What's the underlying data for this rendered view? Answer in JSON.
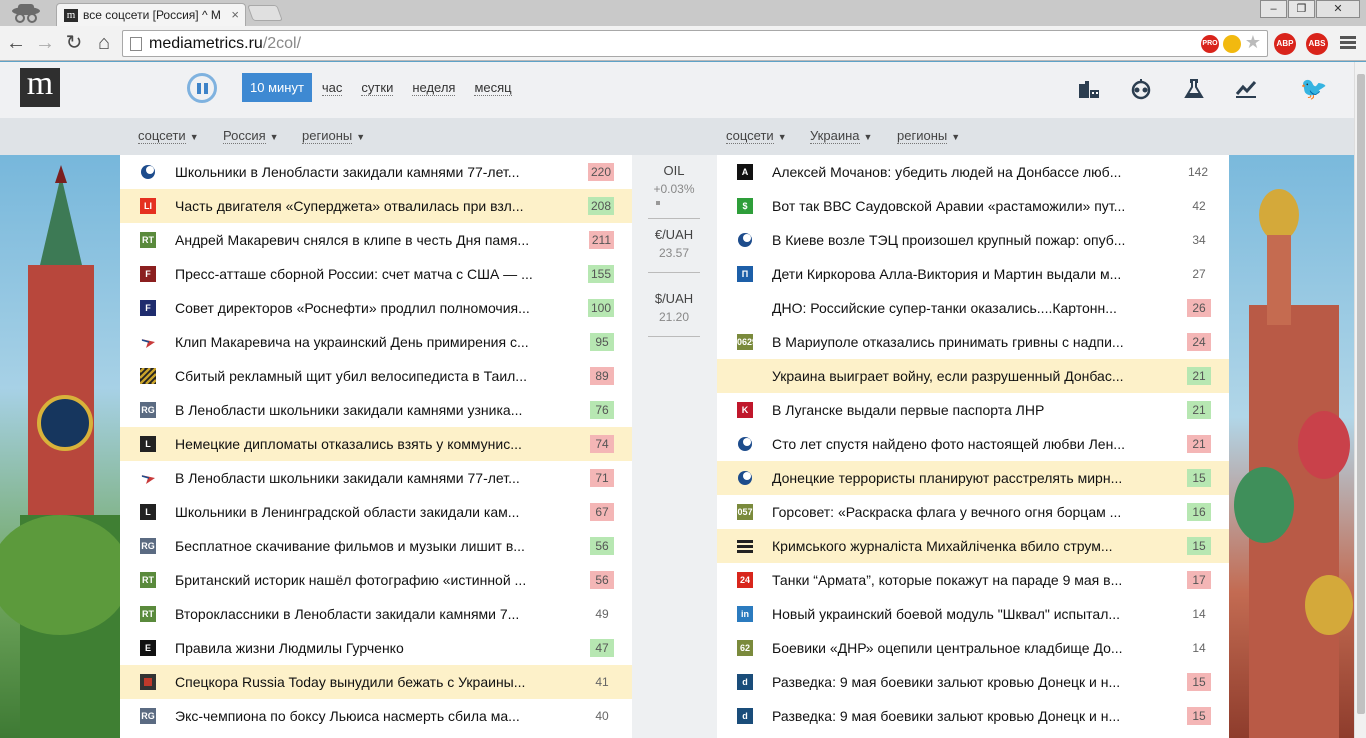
{
  "browser": {
    "tab_title": "все соцсети [Россия] ^ М",
    "url_host": "mediametrics.ru",
    "url_path": "/2col/",
    "ext_abp": "ABP",
    "ext_abs": "ABS",
    "ext_pro": "PRO"
  },
  "site": {
    "logo_letter": "m",
    "periods": [
      "10 минут",
      "час",
      "сутки",
      "неделя",
      "месяц"
    ],
    "left_filters": [
      "соцсети",
      "Россия",
      "регионы"
    ],
    "right_filters": [
      "соцсети",
      "Украина",
      "регионы"
    ]
  },
  "rates": [
    {
      "name": "OIL",
      "value": "+0.03%"
    },
    {
      "name": "€/UAH",
      "value": "23.57"
    },
    {
      "name": "$/UAH",
      "value": "21.20"
    }
  ],
  "left_news": [
    {
      "title": "Школьники в Ленобласти закидали камнями 77-лет...",
      "count": "220",
      "color": "red",
      "hl": false,
      "src": "moon",
      "srcColor": "#1d4c8c"
    },
    {
      "title": "Часть двигателя «Суперджета» отвалилась при взл...",
      "count": "208",
      "color": "green",
      "hl": true,
      "src": "LI",
      "srcColor": "#e53020"
    },
    {
      "title": "Андрей Макаревич снялся в клипе в честь Дня памя...",
      "count": "211",
      "color": "red",
      "hl": false,
      "src": "RT",
      "srcColor": "#5a8a3c"
    },
    {
      "title": "Пресс-атташе сборной России: счет матча с США — ...",
      "count": "155",
      "color": "green",
      "hl": false,
      "src": "F",
      "srcColor": "#8b1f1f"
    },
    {
      "title": "Совет директоров «Роснефти» продлил полномочия...",
      "count": "100",
      "color": "green",
      "hl": false,
      "src": "F",
      "srcColor": "#1f2c6e"
    },
    {
      "title": "Клип Макаревича на украинский День примирения с...",
      "count": "95",
      "color": "green",
      "hl": false,
      "src": "bird",
      "srcColor": "#c83a3a"
    },
    {
      "title": "Сбитый рекламный щит убил велосипедиста в Таил...",
      "count": "89",
      "color": "red",
      "hl": false,
      "src": "stripes",
      "srcColor": "#c9a32a"
    },
    {
      "title": "В Ленобласти школьники закидали камнями узника...",
      "count": "76",
      "color": "green",
      "hl": false,
      "src": "RG",
      "srcColor": "#5b6b82"
    },
    {
      "title": "Немецкие дипломаты отказались взять у коммунис...",
      "count": "74",
      "color": "red",
      "hl": true,
      "src": "L",
      "srcColor": "#222222"
    },
    {
      "title": "В Ленобласти школьники закидали камнями 77-лет...",
      "count": "71",
      "color": "red",
      "hl": false,
      "src": "bird",
      "srcColor": "#c83a3a"
    },
    {
      "title": "Школьники в Ленинградской области закидали кам...",
      "count": "67",
      "color": "red",
      "hl": false,
      "src": "L",
      "srcColor": "#222222"
    },
    {
      "title": "Бесплатное скачивание фильмов и музыки лишит в...",
      "count": "56",
      "color": "green",
      "hl": false,
      "src": "RG",
      "srcColor": "#5b6b82"
    },
    {
      "title": "Британский историк нашёл фотографию «истинной ...",
      "count": "56",
      "color": "red",
      "hl": false,
      "src": "RT",
      "srcColor": "#5a8a3c"
    },
    {
      "title": "Второклассники в Ленобласти закидали камнями 7...",
      "count": "49",
      "color": "plain",
      "hl": false,
      "src": "RT",
      "srcColor": "#5a8a3c"
    },
    {
      "title": "Правила жизни Людмилы Гурченко",
      "count": "47",
      "color": "green",
      "hl": false,
      "src": "E",
      "srcColor": "#111111"
    },
    {
      "title": "Спецкора Russia Today вынудили бежать с Украины...",
      "count": "41",
      "color": "plain",
      "hl": true,
      "src": "sq",
      "srcColor": "#c0392b"
    },
    {
      "title": "Экс-чемпиона по боксу Льюиса насмерть сбила ма...",
      "count": "40",
      "color": "plain",
      "hl": false,
      "src": "RG",
      "srcColor": "#5b6b82"
    }
  ],
  "right_news": [
    {
      "title": "Алексей Мочанов: убедить людей на Донбассе люб...",
      "count": "142",
      "color": "plain",
      "hl": false,
      "src": "A",
      "srcColor": "#111111"
    },
    {
      "title": "Вот так ВВС Саудовской Аравии «растаможили» пут...",
      "count": "42",
      "color": "plain",
      "hl": false,
      "src": "$",
      "srcColor": "#2e9e3a"
    },
    {
      "title": "В Киеве возле ТЭЦ произошел крупный пожар: опуб...",
      "count": "34",
      "color": "plain",
      "hl": false,
      "src": "globe",
      "srcColor": "#1d4c8c"
    },
    {
      "title": "Дети Киркорова Алла-Виктория и Мартин выдали м...",
      "count": "27",
      "color": "plain",
      "hl": false,
      "src": "П",
      "srcColor": "#1d5fa8"
    },
    {
      "title": "ДНО: Российские супер-танки оказались....Картонн...",
      "count": "26",
      "color": "red",
      "hl": false,
      "src": "",
      "srcColor": "transparent"
    },
    {
      "title": "В Мариуполе отказались принимать гривны с надпи...",
      "count": "24",
      "color": "red",
      "hl": false,
      "src": "0629",
      "srcColor": "#7a8a3c"
    },
    {
      "title": "Украина выиграет войну, если разрушенный Донбас...",
      "count": "21",
      "color": "green",
      "hl": true,
      "src": "",
      "srcColor": "transparent"
    },
    {
      "title": "В Луганске выдали первые паспорта ЛНР",
      "count": "21",
      "color": "green",
      "hl": false,
      "src": "K",
      "srcColor": "#c0172b"
    },
    {
      "title": "Сто лет спустя найдено фото настоящей любви Лен...",
      "count": "21",
      "color": "red",
      "hl": false,
      "src": "globe",
      "srcColor": "#1d4c8c"
    },
    {
      "title": "Донецкие террористы планируют расстрелять мирн...",
      "count": "15",
      "color": "green",
      "hl": true,
      "src": "globe",
      "srcColor": "#1d4c8c"
    },
    {
      "title": "Горсовет: «Раскраска флага у вечного огня борцам ...",
      "count": "16",
      "color": "green",
      "hl": false,
      "src": "057",
      "srcColor": "#7a8a3c"
    },
    {
      "title": "Кримського журналіста Михайліченка вбило струм...",
      "count": "15",
      "color": "green",
      "hl": true,
      "src": "lines",
      "srcColor": "#222222"
    },
    {
      "title": "Танки “Армата”, которые покажут на параде 9 мая в...",
      "count": "17",
      "color": "red",
      "hl": false,
      "src": "24",
      "srcColor": "#d8261c"
    },
    {
      "title": "Новый украинский боевой модуль \"Шквал\" испытал...",
      "count": "14",
      "color": "plain",
      "hl": false,
      "src": "in",
      "srcColor": "#2b7bbf"
    },
    {
      "title": "Боевики «ДНР» оцепили центральное кладбище До...",
      "count": "14",
      "color": "plain",
      "hl": false,
      "src": "62",
      "srcColor": "#7a8a3c"
    },
    {
      "title": "Разведка: 9 мая боевики зальют кровью Донецк и н...",
      "count": "15",
      "color": "red",
      "hl": false,
      "src": "d",
      "srcColor": "#1a4d7a"
    },
    {
      "title": "Разведка: 9 мая боевики зальют кровью Донецк и н...",
      "count": "15",
      "color": "red",
      "hl": false,
      "src": "d",
      "srcColor": "#1a4d7a"
    }
  ]
}
